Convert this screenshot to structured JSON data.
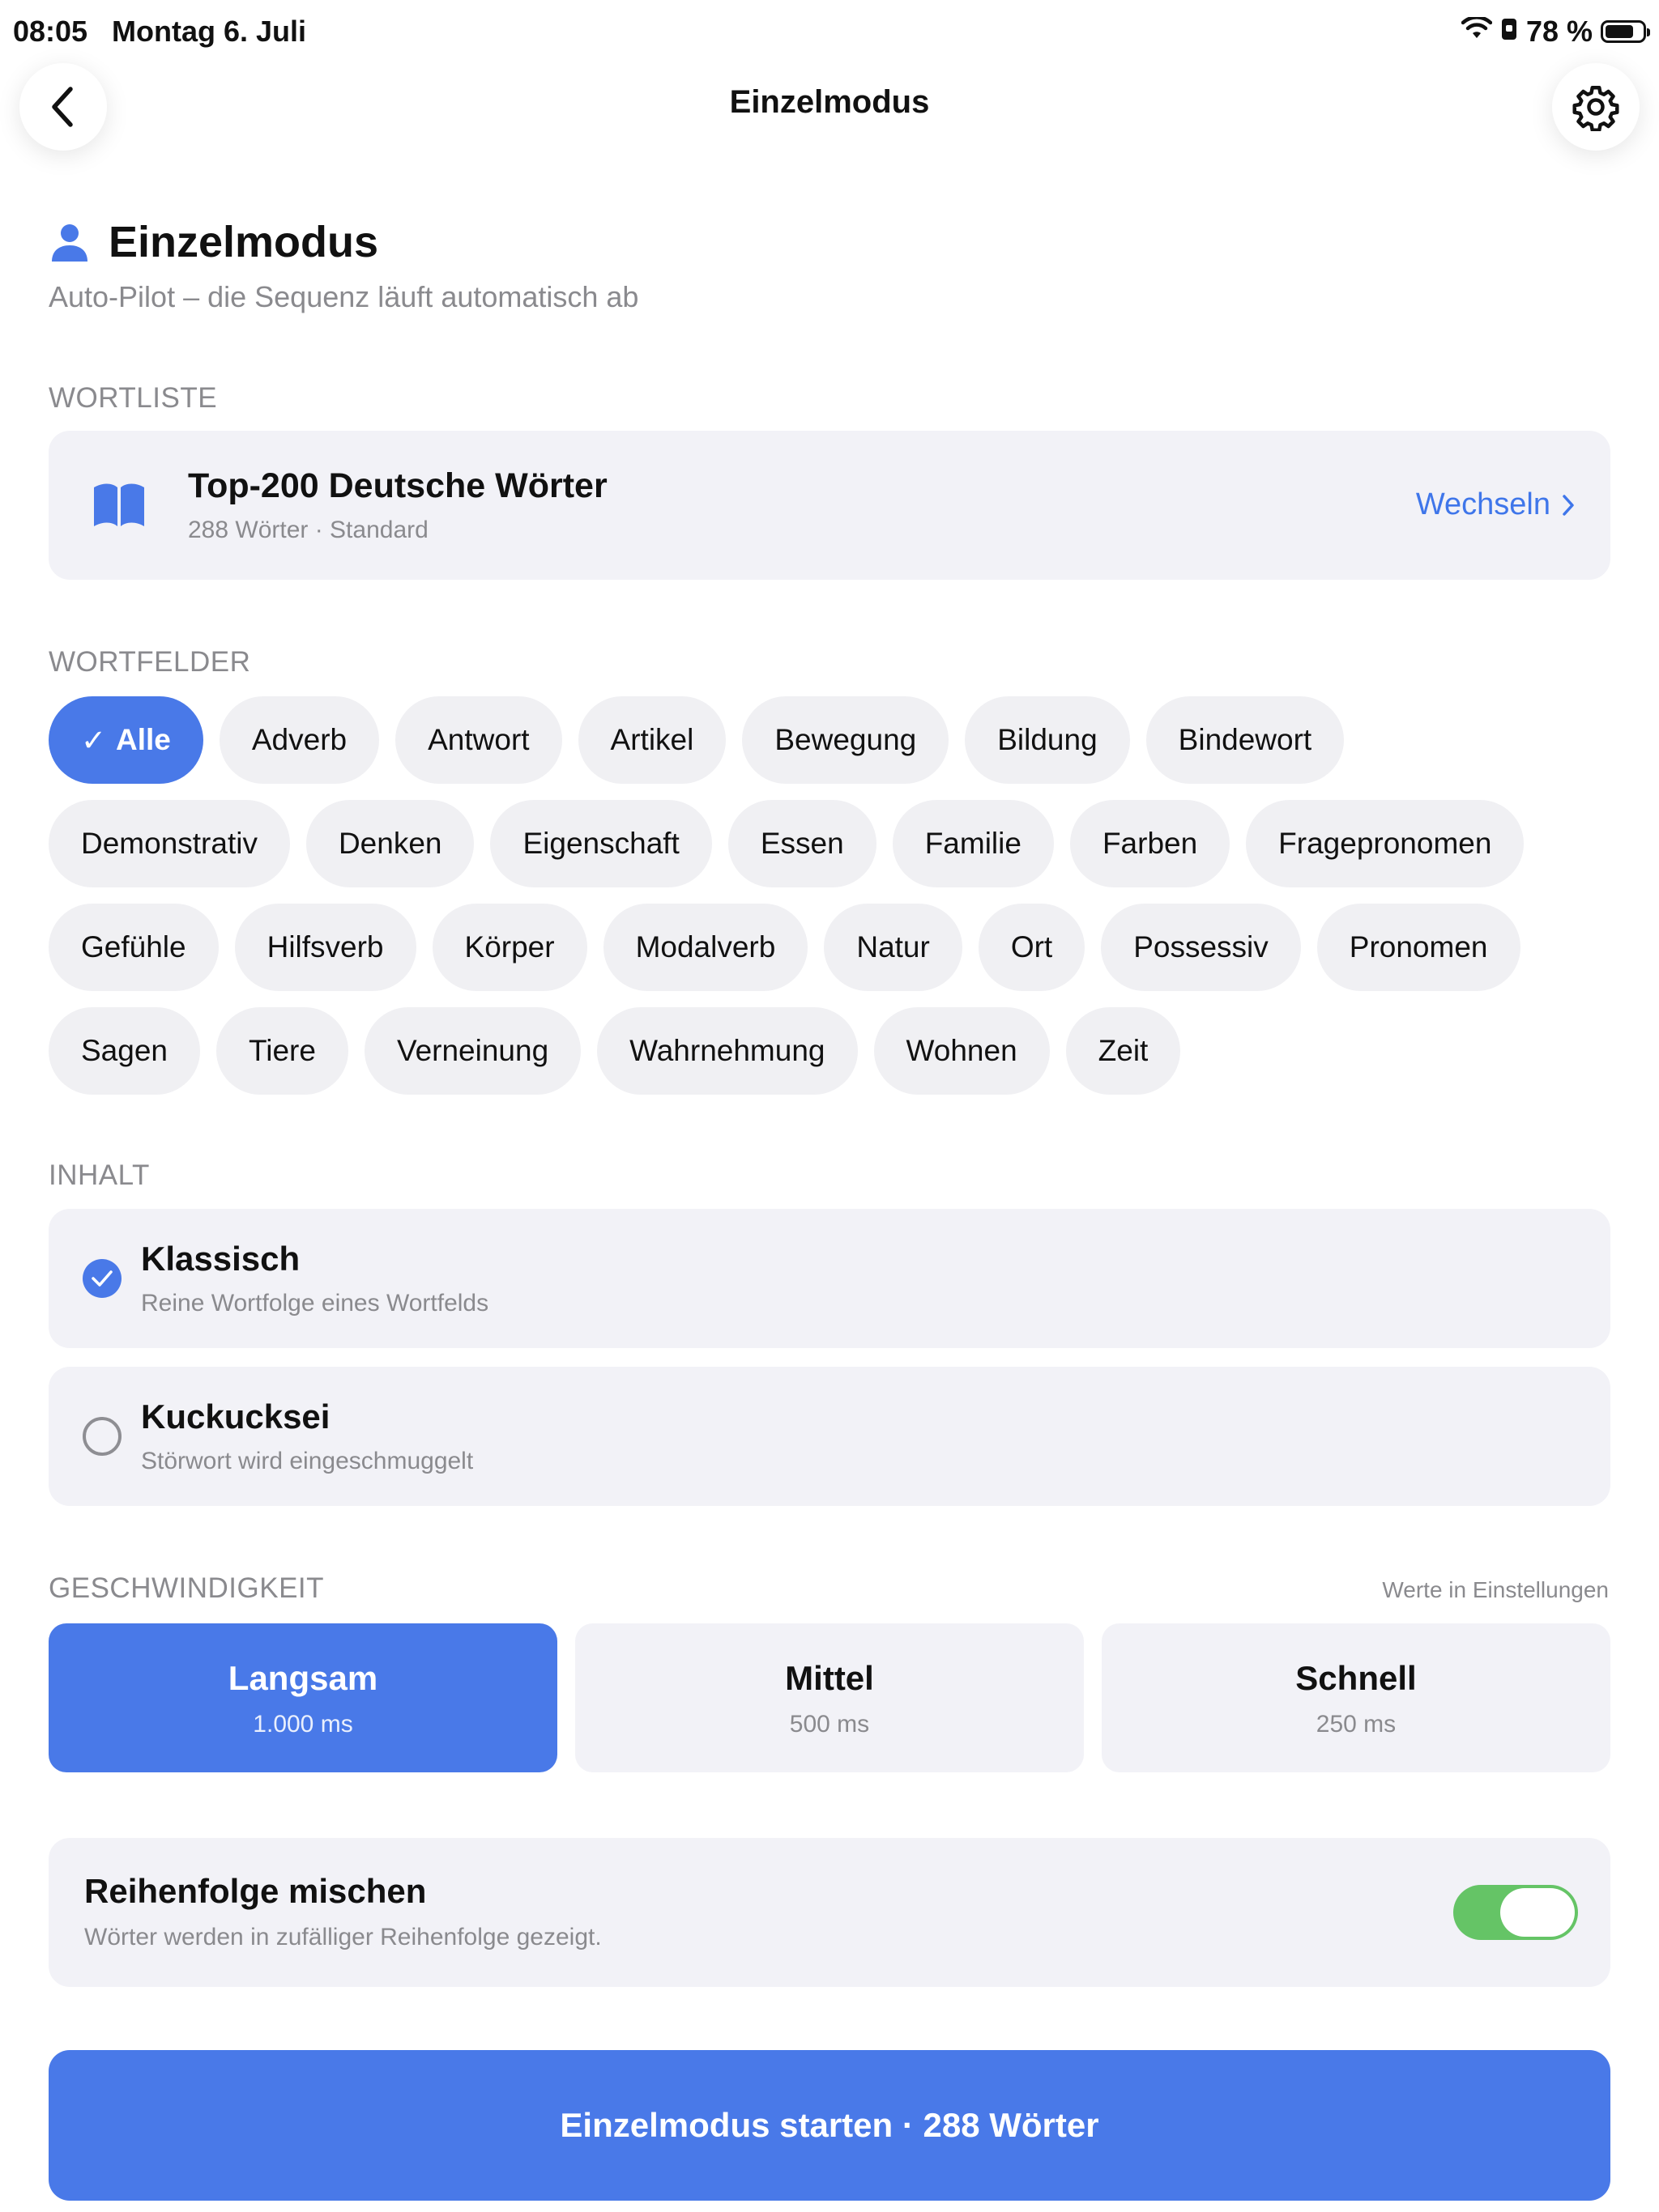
{
  "status": {
    "time": "08:05",
    "date": "Montag 6. Juli",
    "battery": "78 %",
    "battery_level": 0.78
  },
  "nav": {
    "title": "Einzelmodus"
  },
  "header": {
    "title": "Einzelmodus",
    "subtitle": "Auto-Pilot – die Sequenz läuft automatisch ab"
  },
  "wordlist": {
    "section_label": "WORTLISTE",
    "title": "Top-200 Deutsche Wörter",
    "meta": "288 Wörter · Standard",
    "change_label": "Wechseln"
  },
  "fields": {
    "section_label": "WORTFELDER",
    "selected": "Alle",
    "rows": [
      [
        "Alle",
        "Adverb",
        "Antwort",
        "Artikel",
        "Bewegung",
        "Bildung",
        "Bindewort"
      ],
      [
        "Demonstrativ",
        "Denken",
        "Eigenschaft",
        "Essen",
        "Familie",
        "Farben",
        "Fragepronomen"
      ],
      [
        "Gefühle",
        "Hilfsverb",
        "Körper",
        "Modalverb",
        "Natur",
        "Ort",
        "Possessiv",
        "Pronomen"
      ],
      [
        "Sagen",
        "Tiere",
        "Verneinung",
        "Wahrnehmung",
        "Wohnen",
        "Zeit"
      ]
    ]
  },
  "content": {
    "section_label": "INHALT",
    "options": [
      {
        "title": "Klassisch",
        "subtitle": "Reine Wortfolge eines Wortfelds",
        "selected": true
      },
      {
        "title": "Kuckucksei",
        "subtitle": "Störwort wird eingeschmuggelt",
        "selected": false
      }
    ]
  },
  "speed": {
    "section_label": "GESCHWINDIGKEIT",
    "note": "Werte in Einstellungen",
    "options": [
      {
        "label": "Langsam",
        "ms": "1.000 ms",
        "selected": true
      },
      {
        "label": "Mittel",
        "ms": "500 ms",
        "selected": false
      },
      {
        "label": "Schnell",
        "ms": "250 ms",
        "selected": false
      }
    ]
  },
  "shuffle": {
    "title": "Reihenfolge mischen",
    "subtitle": "Wörter werden in zufälliger Reihenfolge gezeigt.",
    "enabled": true
  },
  "start_button": "Einzelmodus starten · 288 Wörter",
  "colors": {
    "accent": "#4979e8",
    "link": "#3f76ea",
    "toggle_on": "#65c466",
    "card_bg": "#f2f2f7",
    "secondary_text": "#8a8a8e"
  }
}
